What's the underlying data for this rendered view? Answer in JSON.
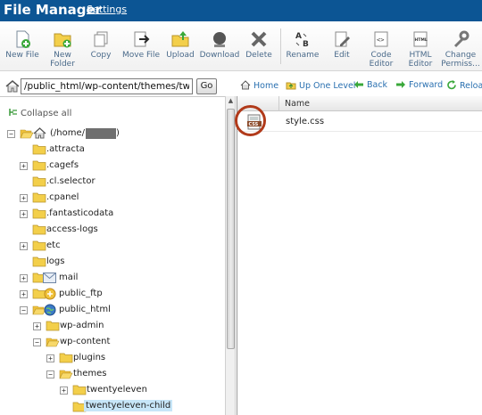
{
  "header": {
    "title": "File Manager",
    "settings_label": "Settings"
  },
  "toolbar": {
    "items": [
      {
        "label": "New File",
        "icon": "new-file-icon"
      },
      {
        "label": "New\nFolder",
        "icon": "new-folder-icon"
      },
      {
        "label": "Copy",
        "icon": "copy-icon"
      },
      {
        "label": "Move File",
        "icon": "move-file-icon"
      },
      {
        "label": "Upload",
        "icon": "upload-icon"
      },
      {
        "label": "Download",
        "icon": "download-icon"
      },
      {
        "label": "Delete",
        "icon": "delete-icon"
      },
      {
        "label": "Rename",
        "icon": "rename-icon"
      },
      {
        "label": "Edit",
        "icon": "edit-icon"
      },
      {
        "label": "Code\nEditor",
        "icon": "code-editor-icon"
      },
      {
        "label": "HTML\nEditor",
        "icon": "html-editor-icon"
      },
      {
        "label": "Change\nPermiss...",
        "icon": "permissions-icon"
      }
    ]
  },
  "pathbar": {
    "path_value": "/public_html/wp-content/themes/twentye",
    "go_label": "Go"
  },
  "nav": {
    "home": "Home",
    "up": "Up One Level",
    "back": "Back",
    "forward": "Forward",
    "reload": "Reload"
  },
  "tree": {
    "collapse_label": "Collapse all",
    "root_label": "(/home/",
    "nodes": {
      "attracta": ".attracta",
      "cagefs": ".cagefs",
      "clselector": ".cl.selector",
      "cpanel": ".cpanel",
      "fantasticodata": ".fantasticodata",
      "access_logs": "access-logs",
      "etc": "etc",
      "logs": "logs",
      "mail": "mail",
      "public_ftp": "public_ftp",
      "public_html": "public_html",
      "wp_admin": "wp-admin",
      "wp_content": "wp-content",
      "plugins": "plugins",
      "themes": "themes",
      "twentyeleven": "twentyeleven",
      "twentyeleven_child": "twentyeleven-child"
    }
  },
  "filelist": {
    "column_name": "Name",
    "files": [
      {
        "name": "style.css"
      }
    ]
  },
  "colors": {
    "header_bg": "#0c5594",
    "link": "#2a70b0",
    "highlight": "#b13a1a",
    "selected": "#c7e6f8"
  }
}
